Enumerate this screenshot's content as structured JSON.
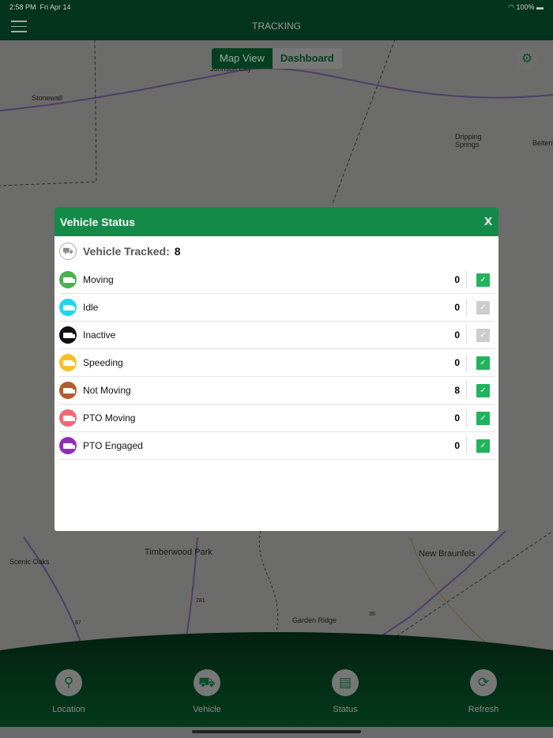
{
  "status_bar": {
    "time": "2:58 PM",
    "date": "Fri Apr 14",
    "battery": "100%"
  },
  "header": {
    "title": "TRACKING"
  },
  "view_toggle": {
    "map_view": "Map View",
    "dashboard": "Dashboard"
  },
  "map": {
    "labels": [
      "Stonewall",
      "Johnson City",
      "Dripping Springs",
      "Belterra",
      "Timberwood Park",
      "Scenic Oaks",
      "New Braunfels",
      "Garden Ridge",
      "281",
      "87",
      "35"
    ]
  },
  "modal": {
    "title": "Vehicle Status",
    "close": "X",
    "tracked_label": "Vehicle Tracked:",
    "tracked_count": "8",
    "rows": [
      {
        "label": "Moving",
        "count": "0",
        "checked": true,
        "color": "#4caf50"
      },
      {
        "label": "Idle",
        "count": "0",
        "checked": false,
        "color": "#1ed6ef"
      },
      {
        "label": "Inactive",
        "count": "0",
        "checked": false,
        "color": "#111111"
      },
      {
        "label": "Speeding",
        "count": "0",
        "checked": true,
        "color": "#fbbf24"
      },
      {
        "label": "Not Moving",
        "count": "8",
        "checked": true,
        "color": "#b35a2a"
      },
      {
        "label": "PTO Moving",
        "count": "0",
        "checked": true,
        "color": "#f06a73"
      },
      {
        "label": "PTO Engaged",
        "count": "0",
        "checked": true,
        "color": "#8e2fb5"
      }
    ]
  },
  "bottom_nav": [
    {
      "label": "Location"
    },
    {
      "label": "Vehicle"
    },
    {
      "label": "Status"
    },
    {
      "label": "Refresh"
    }
  ]
}
